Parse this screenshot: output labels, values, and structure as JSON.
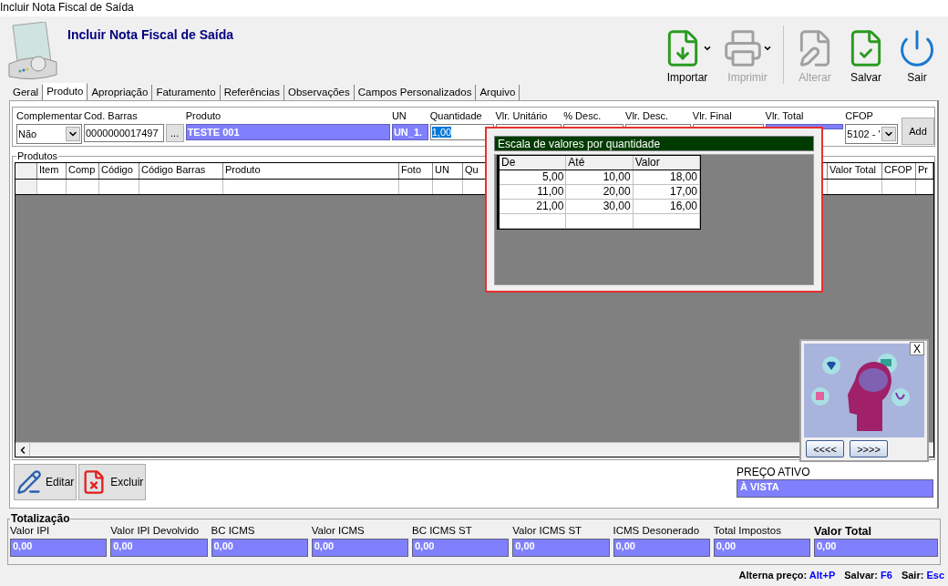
{
  "window": {
    "title": "Incluir Nota Fiscal de Saída"
  },
  "header": {
    "title": "Incluir Nota Fiscal de Saída"
  },
  "toolbar": [
    {
      "label": "Importar",
      "kind": "import",
      "disabled": false,
      "dropdown": true
    },
    {
      "label": "Imprimir",
      "kind": "print",
      "disabled": true,
      "dropdown": true
    },
    {
      "label": "Alterar",
      "kind": "edit",
      "disabled": true,
      "dropdown": false
    },
    {
      "label": "Salvar",
      "kind": "save",
      "disabled": false,
      "dropdown": false
    },
    {
      "label": "Sair",
      "kind": "exit",
      "disabled": false,
      "dropdown": false
    }
  ],
  "tabs": [
    {
      "label": "Geral",
      "selected": false
    },
    {
      "label": "Produto",
      "selected": true
    },
    {
      "label": "Apropriação",
      "selected": false
    },
    {
      "label": "Faturamento",
      "selected": false
    },
    {
      "label": "Referências",
      "selected": false
    },
    {
      "label": "Observações",
      "selected": false
    },
    {
      "label": "Campos Personalizados",
      "selected": false
    },
    {
      "label": "Arquivo",
      "selected": false
    }
  ],
  "entry": {
    "fields": [
      {
        "label": "Complementar",
        "kind": "select",
        "value": "Não"
      },
      {
        "label": "Cod. Barras",
        "kind": "browse",
        "value": "0000000017497",
        "button": "..."
      },
      {
        "label": "Produto",
        "kind": "filled",
        "value": "TESTE 001"
      },
      {
        "label": "UN",
        "kind": "filled",
        "value": "UN_1."
      },
      {
        "label": "Quantidade",
        "kind": "focused",
        "value": "1,00"
      },
      {
        "label": "Vlr. Unitário",
        "kind": "input"
      },
      {
        "label": "% Desc.",
        "kind": "input"
      },
      {
        "label": "Vlr. Desc.",
        "kind": "input"
      },
      {
        "label": "Vlr. Final",
        "kind": "input"
      },
      {
        "label": "Vlr. Total",
        "kind": "filled"
      },
      {
        "label": "CFOP",
        "kind": "select",
        "value": "5102 - '"
      }
    ],
    "add": "Add"
  },
  "grid": {
    "title": "Produtos",
    "columns": [
      "",
      "Item",
      "Comp",
      "Código",
      "Código Barras",
      "Produto",
      "Foto",
      "UN",
      "Qu",
      "Valor Total",
      "CFOP",
      "Pr"
    ]
  },
  "scale_popup": {
    "title": "Escala de valores por quantidade",
    "columns": [
      "De",
      "Até",
      "Valor"
    ],
    "rows": [
      [
        "5,00",
        "10,00",
        "18,00"
      ],
      [
        "11,00",
        "20,00",
        "17,00"
      ],
      [
        "21,00",
        "30,00",
        "16,00"
      ]
    ]
  },
  "image_viewer": {
    "close": "X",
    "prev": "<<<<",
    "next": ">>>>"
  },
  "actions": [
    {
      "label": "Editar",
      "kind": "edit"
    },
    {
      "label": "Excluir",
      "kind": "delete"
    }
  ],
  "price": {
    "label": "PREÇO ATIVO",
    "value": "À VISTA"
  },
  "totals": {
    "title": "Totalização",
    "fields": [
      {
        "label": "Valor IPI",
        "value": "0,00",
        "emphasis": false
      },
      {
        "label": "Valor IPI Devolvido",
        "value": "0,00",
        "emphasis": false
      },
      {
        "label": "BC ICMS",
        "value": "0,00",
        "emphasis": false
      },
      {
        "label": "Valor ICMS",
        "value": "0,00",
        "emphasis": false
      },
      {
        "label": "BC ICMS ST",
        "value": "0,00",
        "emphasis": false
      },
      {
        "label": "Valor ICMS ST",
        "value": "0,00",
        "emphasis": false
      },
      {
        "label": "ICMS Desonerado",
        "value": "0,00",
        "emphasis": false
      },
      {
        "label": "Total Impostos",
        "value": "0,00",
        "emphasis": false
      },
      {
        "label": "Valor Total",
        "value": "0,00",
        "emphasis": true
      }
    ]
  },
  "status": [
    {
      "label": "Alterna preço:",
      "key": "Alt+P"
    },
    {
      "label": "Salvar:",
      "key": "F6"
    },
    {
      "label": "Sair:",
      "key": "Esc"
    }
  ]
}
